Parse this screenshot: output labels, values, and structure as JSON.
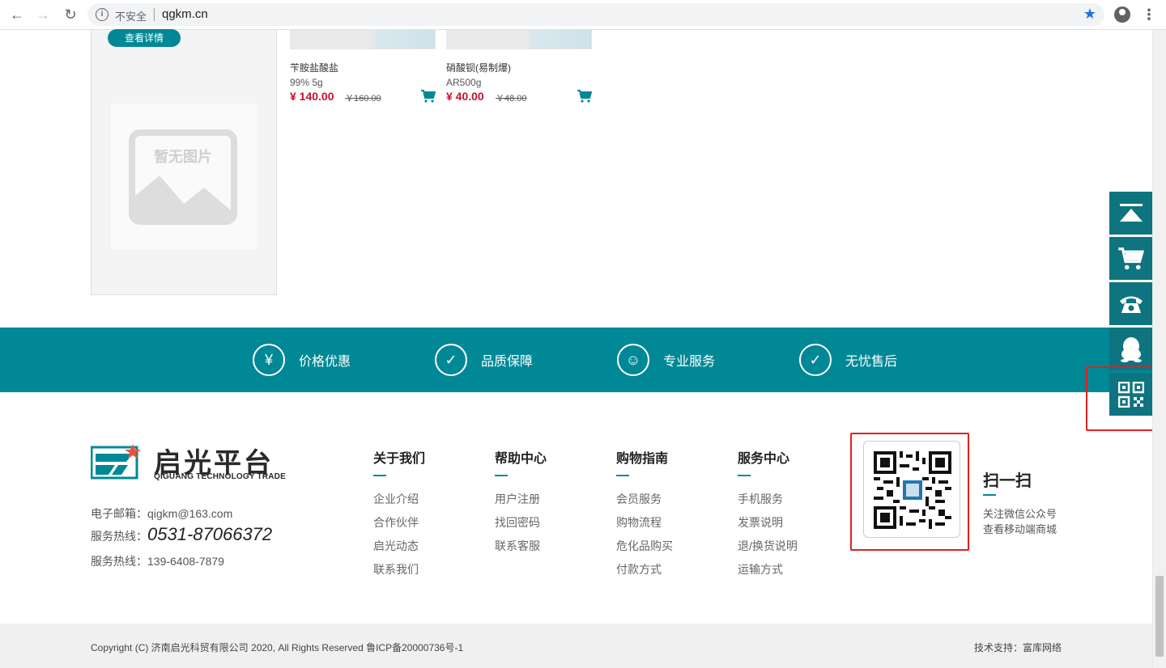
{
  "browser": {
    "back": "←",
    "forward": "→",
    "reload": "↻",
    "insecure_label": "不安全",
    "url": "qgkm.cn",
    "star": "★",
    "menu": "⋮"
  },
  "side": {
    "detail_button": "查看详情",
    "no_image_text": "暂无图片"
  },
  "products": [
    {
      "name": "苄胺盐酸盐",
      "spec": "99% 5g",
      "price": "¥ 140.00",
      "old_price": "￥160.00"
    },
    {
      "name": "硝酸钡(易制爆)",
      "spec": "AR500g",
      "price": "¥ 40.00",
      "old_price": "￥48.00"
    }
  ],
  "features": [
    {
      "icon": "yen-icon",
      "glyph": "¥",
      "label": "价格优惠"
    },
    {
      "icon": "shield-check-icon",
      "glyph": "✓",
      "label": "品质保障"
    },
    {
      "icon": "user-check-icon",
      "glyph": "☺",
      "label": "专业服务"
    },
    {
      "icon": "shield-check-icon",
      "glyph": "✓",
      "label": "无忧售后"
    }
  ],
  "footer": {
    "logo_cn": "启光平台",
    "logo_en": "QIGUANG TECHNOLOGY TRADE",
    "email": "电子邮箱：qigkm@163.com",
    "hotline_label": "服务热线：",
    "hotline": "0531-87066372",
    "hotline2": "服务热线：139-6408-7879",
    "columns": [
      {
        "title": "关于我们",
        "links": [
          "企业介绍",
          "合作伙伴",
          "启光动态",
          "联系我们"
        ]
      },
      {
        "title": "帮助中心",
        "links": [
          "用户注册",
          "找回密码",
          "联系客服"
        ]
      },
      {
        "title": "购物指南",
        "links": [
          "会员服务",
          "购物流程",
          "危化品购买",
          "付款方式"
        ]
      },
      {
        "title": "服务中心",
        "links": [
          "手机服务",
          "发票说明",
          "退/换货说明",
          "运输方式"
        ]
      }
    ],
    "scan_title": "扫一扫",
    "scan_line1": "关注微信公众号",
    "scan_line2": "查看移动端商城",
    "copyright": "Copyright (C) 济南启光科贸有限公司 2020, All Rights Reserved 鲁ICP备20000736号-1",
    "tech_support": "技术支持：富库网络"
  },
  "colors": {
    "brand": "#008896",
    "float": "#0e7480",
    "price": "#c8102e",
    "highlight": "#e02020"
  }
}
